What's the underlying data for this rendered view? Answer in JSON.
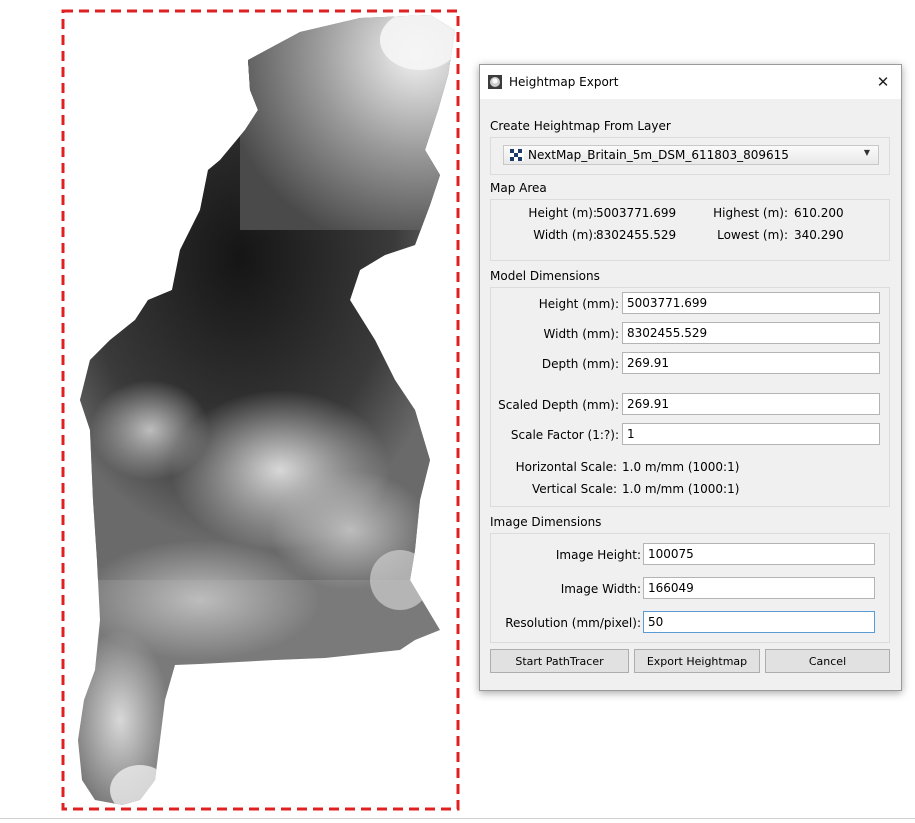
{
  "dialog": {
    "title": "Heightmap Export",
    "close_label": "✕",
    "layer_section": {
      "label": "Create Heightmap From Layer",
      "selected_layer": "NextMap_Britain_5m_DSM_611803_809615"
    },
    "map_area": {
      "label": "Map Area",
      "height_label": "Height (m):",
      "height_value": "5003771.699",
      "width_label": "Width (m):",
      "width_value": "8302455.529",
      "highest_label": "Highest (m):",
      "highest_value": "610.200",
      "lowest_label": "Lowest (m):",
      "lowest_value": "340.290"
    },
    "model_dimensions": {
      "label": "Model Dimensions",
      "height_label": "Height (mm):",
      "height_value": "5003771.699",
      "width_label": "Width (mm):",
      "width_value": "8302455.529",
      "depth_label": "Depth (mm):",
      "depth_value": "269.91",
      "scaled_depth_label": "Scaled Depth (mm):",
      "scaled_depth_value": "269.91",
      "scale_factor_label": "Scale Factor (1:?):",
      "scale_factor_value": "1",
      "horizontal_scale_label": "Horizontal Scale:",
      "horizontal_scale_value": "1.0 m/mm (1000:1)",
      "vertical_scale_label": "Vertical Scale:",
      "vertical_scale_value": "1.0 m/mm (1000:1)"
    },
    "image_dimensions": {
      "label": "Image Dimensions",
      "image_height_label": "Image Height:",
      "image_height_value": "100075",
      "image_width_label": "Image Width:",
      "image_width_value": "166049",
      "resolution_label": "Resolution (mm/pixel):",
      "resolution_value": "50"
    },
    "buttons": {
      "start_pathtracer": "Start PathTracer",
      "export_heightmap": "Export Heightmap",
      "cancel": "Cancel"
    }
  },
  "colors": {
    "selection_border": "#e02020",
    "dialog_bg": "#f0f0f0",
    "focus_border": "#5b9bd5"
  },
  "icons": {
    "title": "heightmap-app-icon",
    "layer": "raster-layer-icon",
    "dropdown": "chevron-down-icon",
    "close": "close-icon"
  }
}
